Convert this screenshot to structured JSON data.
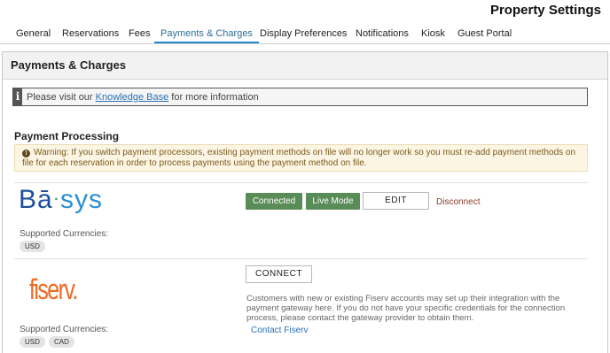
{
  "page_title": "Property Settings",
  "tabs": [
    {
      "label": "General",
      "active": false
    },
    {
      "label": "Reservations",
      "active": false
    },
    {
      "label": "Fees",
      "active": false
    },
    {
      "label": "Payments & Charges",
      "active": true
    },
    {
      "label": "Display Preferences",
      "active": false
    },
    {
      "label": "Notifications",
      "active": false
    },
    {
      "label": "Kiosk",
      "active": false
    },
    {
      "label": "Guest Portal",
      "active": false
    }
  ],
  "panel": {
    "title": "Payments & Charges",
    "kb_notice": {
      "icon": "info-icon",
      "prefix": "Please visit our ",
      "link": "Knowledge Base",
      "suffix": " for more information"
    },
    "section_title": "Payment Processing",
    "warning": {
      "icon": "exclamation-icon",
      "text": "Warning: If you switch payment processors, existing payment methods on file will no longer work so you must re-add payment methods on file for each reservation in order to process payments using the payment method on file."
    }
  },
  "processors": {
    "basys": {
      "logo_text_a": "Bā",
      "logo_dot": "·",
      "logo_text_b": "sys",
      "connected_label": "Connected",
      "mode_label": "Live Mode",
      "edit_label": "EDIT",
      "disconnect_label": "Disconnect",
      "supported_label": "Supported Currencies:",
      "currencies": [
        "USD"
      ]
    },
    "fiserv": {
      "logo_text": "fiserv.",
      "connect_label": "CONNECT",
      "description": "Customers with new or existing Fiserv accounts may set up their integration with the payment gateway here. If you do not have your specific credentials for the connection process, please contact the gateway provider to obtain them.",
      "contact_label": "Contact Fiserv",
      "supported_label": "Supported Currencies:",
      "currencies": [
        "USD",
        "CAD"
      ]
    }
  },
  "colors": {
    "accent": "#2b86c5",
    "connected_green": "#5a8c58",
    "warning_bg": "#fcf5e3",
    "link": "#2b6fb5",
    "fiserv_orange": "#f06a22",
    "basys_blue": "#1e4e99"
  }
}
